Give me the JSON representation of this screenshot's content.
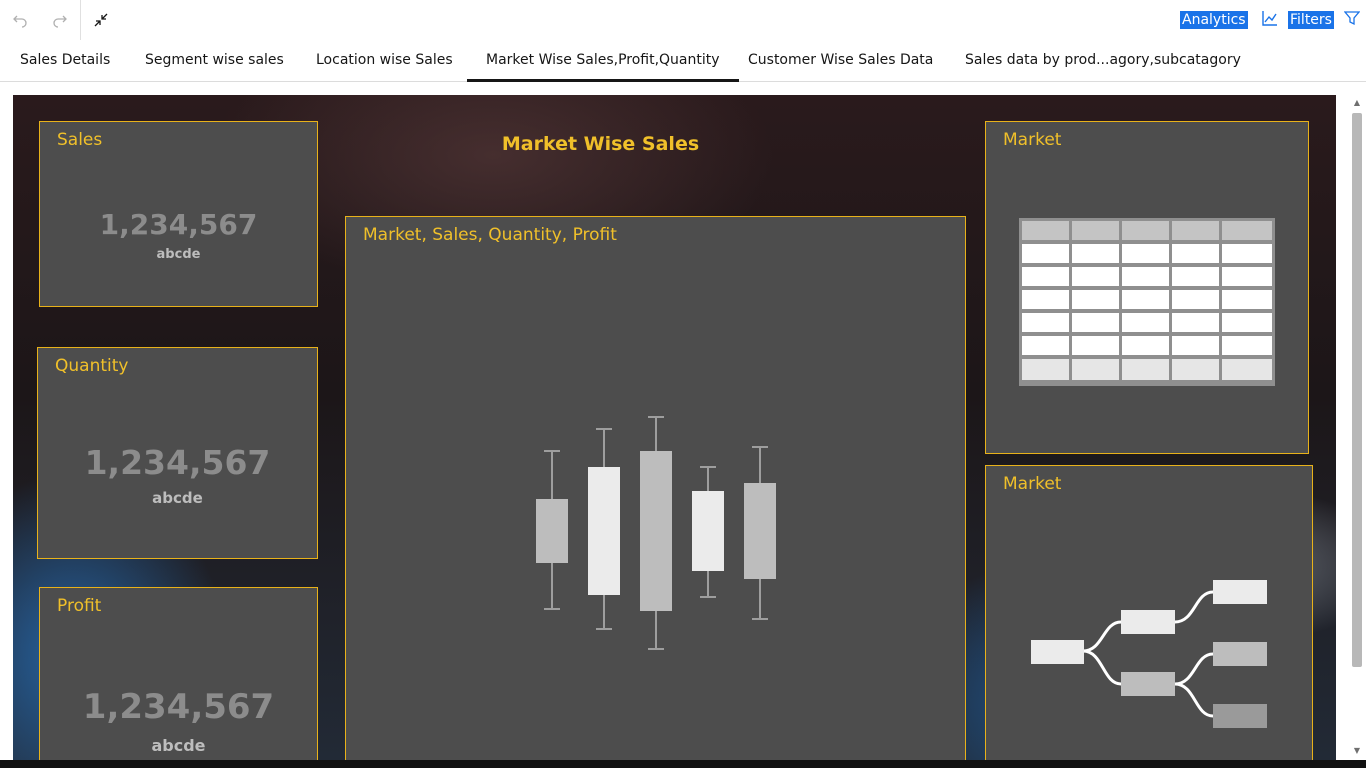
{
  "toolbar": {
    "analytics_label": "Analytics",
    "filters_label": "Filters"
  },
  "tabs": [
    {
      "label": "Sales Details",
      "active": false
    },
    {
      "label": "Segment wise sales",
      "active": false
    },
    {
      "label": "Location wise Sales",
      "active": false
    },
    {
      "label": "Market Wise Sales,Profit,Quantity",
      "active": true
    },
    {
      "label": "Customer Wise Sales Data",
      "active": false
    },
    {
      "label": "Sales data by prod...agory,subcatagory",
      "active": false
    }
  ],
  "dashboard": {
    "title": "Market Wise Sales",
    "kpis": [
      {
        "title": "Sales",
        "value": "1,234,567",
        "sub": "abcde"
      },
      {
        "title": "Quantity",
        "value": "1,234,567",
        "sub": "abcde"
      },
      {
        "title": "Profit",
        "value": "1,234,567",
        "sub": "abcde"
      }
    ],
    "main_chart": {
      "title": "Market, Sales, Quantity, Profit"
    },
    "table_widget": {
      "title": "Market"
    },
    "tree_widget": {
      "title": "Market"
    }
  },
  "colors": {
    "accent": "#f0c02a",
    "card_bg": "#4d4d4d",
    "card_border": "#e8b21a",
    "selection": "#1a73e8"
  }
}
